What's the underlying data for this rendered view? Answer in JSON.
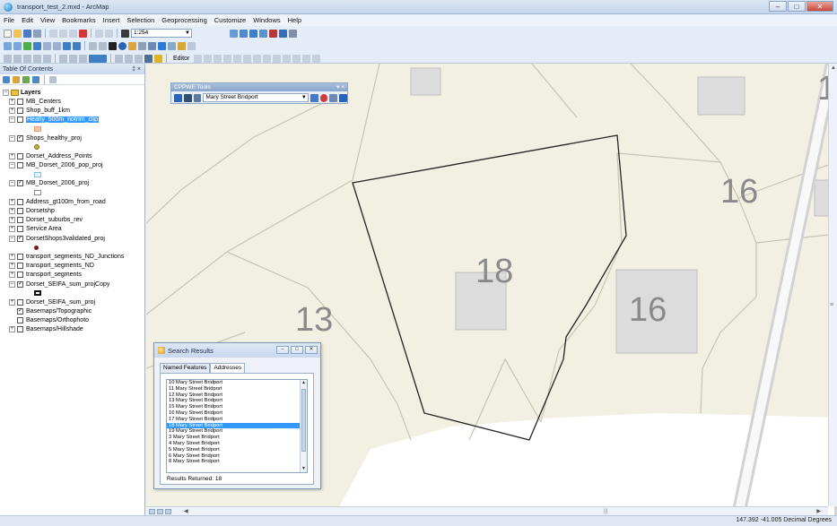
{
  "window": {
    "title": "transport_test_2.mxd - ArcMap"
  },
  "menu": [
    "File",
    "Edit",
    "View",
    "Bookmarks",
    "Insert",
    "Selection",
    "Geoprocessing",
    "Customize",
    "Windows",
    "Help"
  ],
  "toolbar": {
    "scale": "1:254",
    "editor_label": "Editor"
  },
  "toc": {
    "title": "Table Of Contents",
    "root": "Layers",
    "layers": [
      {
        "label": "MB_Centers",
        "checked": false,
        "symbol": null
      },
      {
        "label": "Shop_buff_1km",
        "checked": false,
        "symbol": null
      },
      {
        "label": "Healty_500m_notrim_clip",
        "checked": false,
        "symbol": "peach-rect",
        "selected": true
      },
      {
        "label": "Shops_healthy_proj",
        "checked": true,
        "symbol": "olive-dot"
      },
      {
        "label": "Dorset_Address_Points",
        "checked": false,
        "symbol": null
      },
      {
        "label": "MB_Dorset_2006_pop_proj",
        "checked": false,
        "symbol": "lightblue-rect"
      },
      {
        "label": "MB_Dorset_2006_proj",
        "checked": true,
        "symbol": "white-rect"
      },
      {
        "label": "Address_gt100m_from_road",
        "checked": false,
        "symbol": null
      },
      {
        "label": "Dorsetshp",
        "checked": false,
        "symbol": null
      },
      {
        "label": "Dorset_suburbs_rev",
        "checked": false,
        "symbol": null
      },
      {
        "label": "Service Area",
        "checked": false,
        "symbol": null
      },
      {
        "label": "DorsetShops3validated_proj",
        "checked": true,
        "symbol": "maroon-dot"
      },
      {
        "label": "transport_segments_ND_Junctions",
        "checked": false,
        "symbol": null
      },
      {
        "label": "transport_segments_ND",
        "checked": false,
        "symbol": null
      },
      {
        "label": "transport_segments",
        "checked": false,
        "symbol": null
      },
      {
        "label": "Dorset_SEIFA_sum_projCopy",
        "checked": true,
        "symbol": "black-rect"
      },
      {
        "label": "Dorset_SEIFA_sum_proj",
        "checked": false,
        "symbol": null
      },
      {
        "label": "Basemaps/Topographic",
        "checked": true,
        "symbol": null,
        "noexp": true
      },
      {
        "label": "Basemaps/Orthophoto",
        "checked": false,
        "symbol": null,
        "noexp": true
      },
      {
        "label": "Basemaps/Hillshade",
        "checked": false,
        "symbol": null
      }
    ]
  },
  "cppwe": {
    "title": "CPPWE Tools",
    "selected_address": "Mary Street Bridport"
  },
  "map": {
    "labels": [
      "18",
      "16",
      "16",
      "13",
      "1"
    ]
  },
  "search_dialog": {
    "title": "Search Results",
    "tabs": [
      "Named Features",
      "Addresses"
    ],
    "active_tab": "Addresses",
    "results": [
      "10 Mary Street Bridport",
      "11 Mary Street Bridport",
      "12 Mary Street Bridport",
      "13 Mary Street Bridport",
      "15 Mary Street Bridport",
      "16 Mary Street Bridport",
      "17 Mary Street Bridport",
      "18 Mary Street Bridport",
      "19 Mary Street Bridport",
      "3 Mary Street Bridport",
      "4 Mary Street Bridport",
      "5 Mary Street Bridport",
      "6 Mary Street Bridport",
      "8 Mary Street Bridport"
    ],
    "selected_index": 7,
    "results_returned": "Results Returned: 18"
  },
  "status": {
    "coords": "147.392 -41.005 Decimal Degrees"
  },
  "colors": {
    "map_background": "#f2f0e3",
    "selection": "#3399ff"
  }
}
